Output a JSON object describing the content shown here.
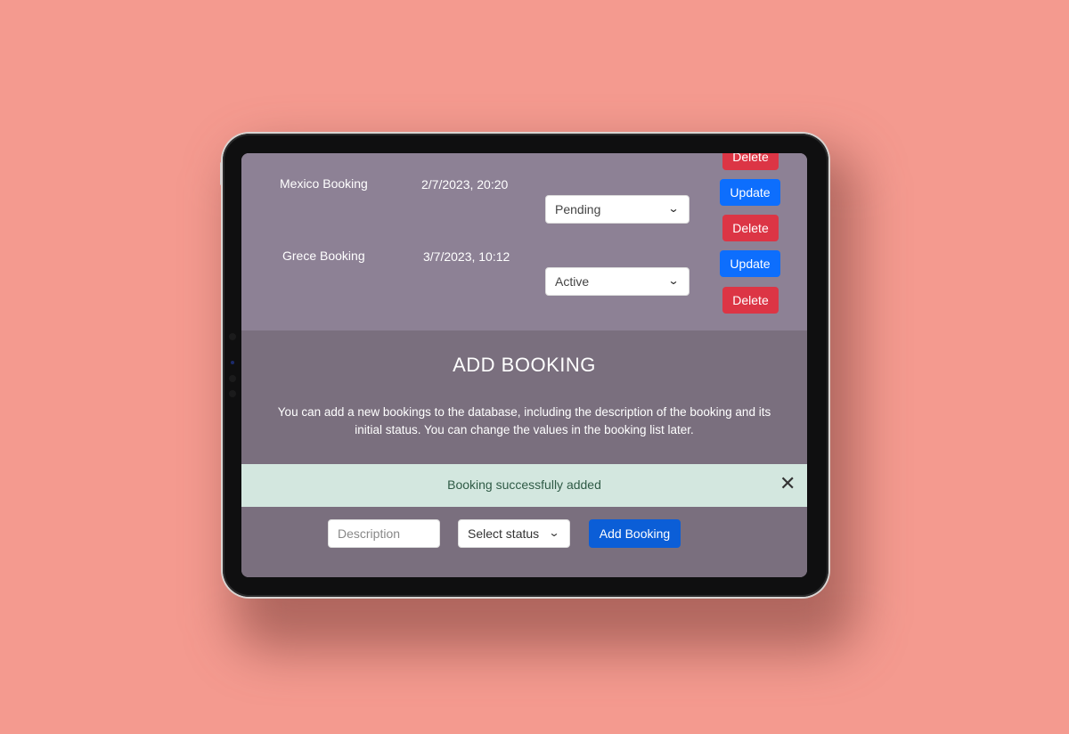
{
  "bookings": [
    {
      "name": "Mexico Booking",
      "date": "2/7/2023, 20:20",
      "status": "Pending",
      "update_label": "Update",
      "delete_label": "Delete"
    },
    {
      "name": "Grece Booking",
      "date": "3/7/2023, 10:12",
      "status": "Active",
      "update_label": "Update",
      "delete_label": "Delete"
    }
  ],
  "top_partial_delete_label": "Delete",
  "add_section": {
    "title": "ADD BOOKING",
    "description": "You can add a new bookings to the database, including the description of the booking and its initial status. You can change the values in the booking list later."
  },
  "alert": {
    "message": "Booking successfully added",
    "close_glyph": "✕"
  },
  "form": {
    "description_placeholder": "Description",
    "status_placeholder": "Select status",
    "add_button": "Add Booking"
  },
  "colors": {
    "background": "#f49a8f",
    "update": "#0d6efd",
    "delete": "#dc3545",
    "alert_bg": "#d3e7df"
  }
}
